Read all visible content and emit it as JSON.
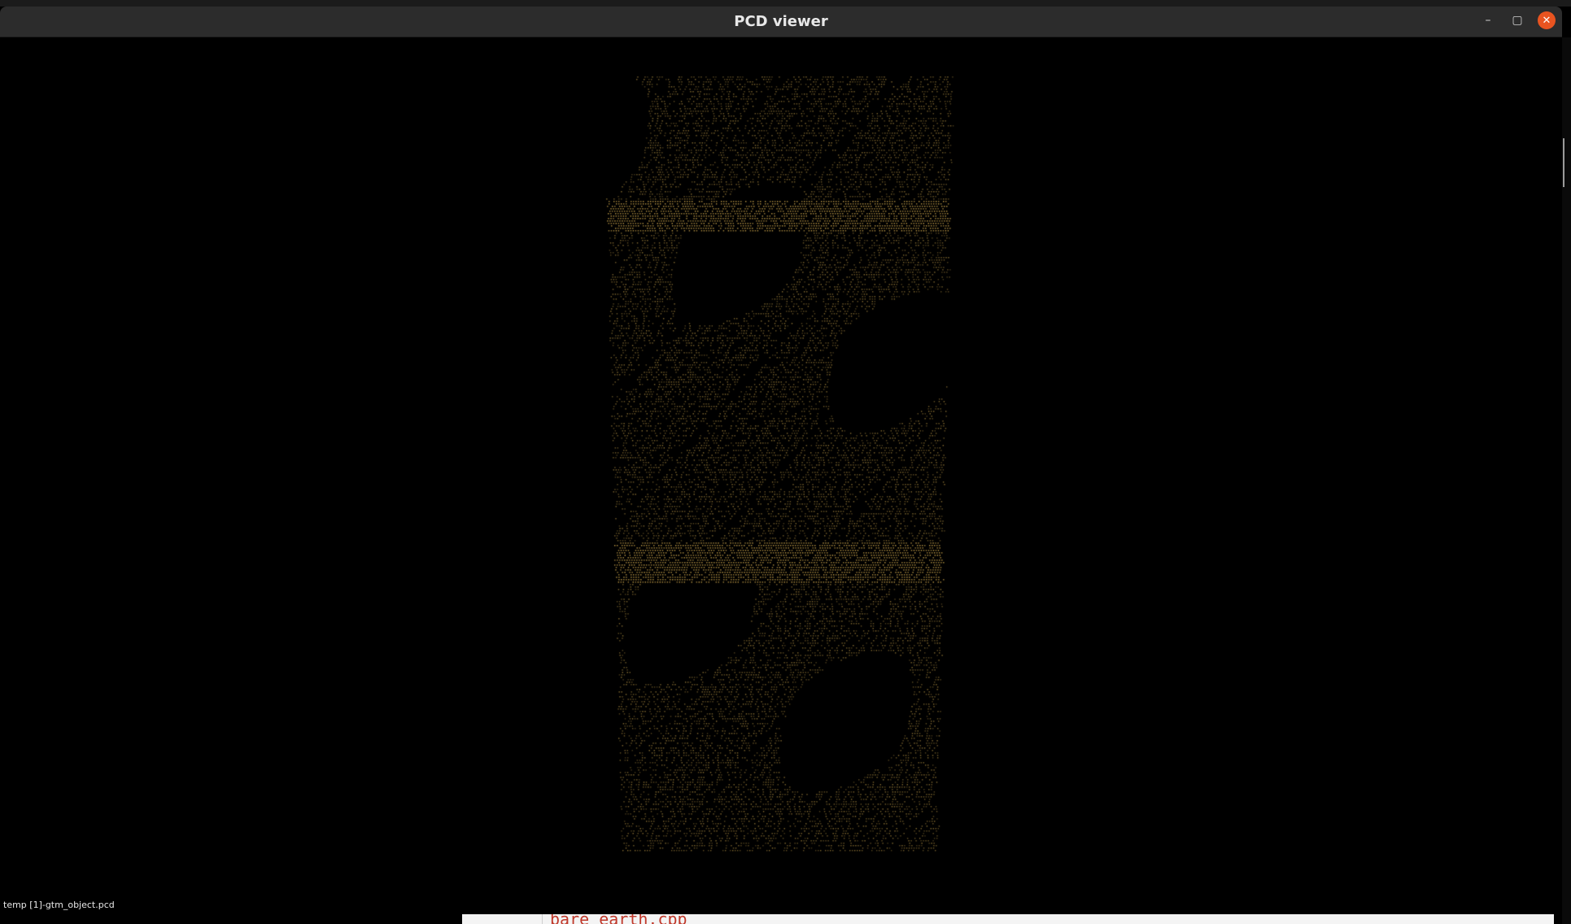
{
  "window": {
    "title": "PCD viewer",
    "controls": {
      "minimize": "–",
      "maximize": "▢",
      "close": "✕"
    }
  },
  "viewer": {
    "background_color": "#000000",
    "point_color": "#c8a24a",
    "status_text": "temp [1]-gtm_object.pcd"
  },
  "background_editor": {
    "peek_text": "bare_earth.cpp"
  },
  "colors": {
    "titlebar": "#2c2c2c",
    "close_accent": "#e95420"
  }
}
